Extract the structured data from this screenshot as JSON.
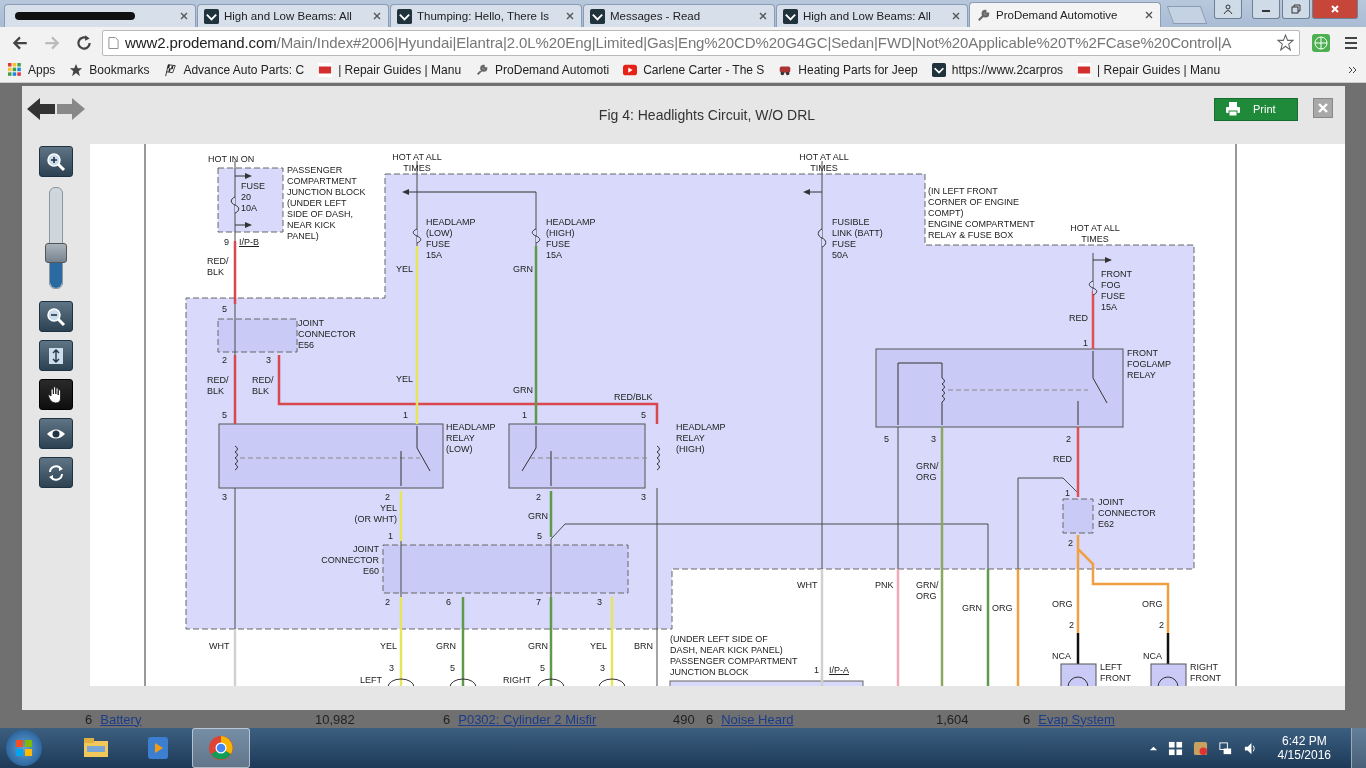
{
  "browser": {
    "tabs": [
      {
        "redacted": true,
        "selected": false
      },
      {
        "title": "High and Low Beams: All",
        "redacted": false,
        "selected": false
      },
      {
        "title": "Thumping: Hello, There Is",
        "redacted": false,
        "selected": false
      },
      {
        "title": "Messages - Read",
        "redacted": false,
        "selected": false
      },
      {
        "title": "High and Low Beams: All",
        "redacted": false,
        "selected": false
      },
      {
        "title": "ProDemand Automotive",
        "redacted": false,
        "selected": true
      }
    ],
    "url_host": "www2.prodemand.com",
    "url_path": "/Main/Index#2006|Hyundai|Elantra|2.0L%20Eng|Limited|Gas|Eng%20CD%20G4GC|Sedan|FWD|Not%20Applicable%20T%2FCase%20Control|A",
    "bookmarks": [
      "Apps",
      "Bookmarks",
      "Advance Auto Parts: C",
      "| Repair Guides | Manu",
      "ProDemand Automoti",
      "Carlene Carter - The S",
      "Heating Parts for Jeep",
      "https://www.2carpros",
      "| Repair Guides | Manu"
    ]
  },
  "viewer": {
    "title": "Fig 4: Headlights Circuit, W/O DRL",
    "print_label": "Print",
    "tools": [
      {
        "selected": false
      },
      {
        "selected": false
      },
      {
        "selected": false
      },
      {
        "selected": true
      },
      {
        "selected": false
      },
      {
        "selected": false
      }
    ],
    "zoom_slider": {
      "level": 0.35
    },
    "diagram_labels": [
      "HOT IN ON",
      "FUSE\n20\n10A",
      "PASSENGER\nCOMPARTMENT\nJUNCTION BLOCK\n(UNDER LEFT\nSIDE OF DASH,\nNEAR KICK\nPANEL)",
      "9",
      "I/P-B",
      "RED/\nBLK",
      "HOT AT ALL\nTIMES",
      "HEADLAMP\n(LOW)\nFUSE\n15A",
      "HEADLAMP\n(HIGH)\nFUSE\n15A",
      "YEL",
      "GRN",
      "5",
      "JOINT\nCONNECTOR\nE56",
      "2",
      "3",
      "RED/\nBLK",
      "RED/\nBLK",
      "YEL",
      "GRN",
      "RED/BLK",
      "5",
      "1",
      "1",
      "5",
      "HEADLAMP\nRELAY\n(LOW)",
      "HEADLAMP\nRELAY\n(HIGH)",
      "3",
      "2",
      "2",
      "3",
      "YEL\n(OR WHT)",
      "GRN",
      "1",
      "5",
      "JOINT\nCONNECTOR\nE60",
      "2",
      "6",
      "7",
      "3",
      "WHT",
      "YEL",
      "GRN",
      "GRN",
      "YEL",
      "BRN",
      "3",
      "5",
      "5",
      "3",
      "LEFT",
      "RIGHT",
      "HOT AT ALL\nTIMES",
      "FUSIBLE\nLINK (BATT)\nFUSE\n50A",
      "(IN LEFT FRONT\nCORNER OF ENGINE\nCOMPT)\nENGINE COMPARTMENT\nRELAY & FUSE BOX",
      "HOT AT ALL\nTIMES",
      "FRONT\nFOG\nFUSE\n15A",
      "RED",
      "1",
      "FRONT\nFOGLAMP\nRELAY",
      "5",
      "3",
      "2",
      "RED",
      "GRN/\nORG",
      "1",
      "JOINT\nCONNECTOR\nE62",
      "2",
      "WHT",
      "PNK",
      "GRN/\nORG",
      "GRN",
      "ORG",
      "ORG",
      "ORG",
      "2",
      "2",
      "NCA",
      "NCA",
      "LEFT\nFRONT",
      "RIGHT\nFRONT",
      "(UNDER LEFT SIDE OF\nDASH, NEAR KICK PANEL)\nPASSENGER COMPARTMENT\nJUNCTION BLOCK",
      "1",
      "I/P-A"
    ]
  },
  "background_list": [
    {
      "rank": "6",
      "name": "Battery",
      "count": "10,982"
    },
    {
      "rank": "6",
      "name": "P0302: Cylinder 2 Misfir",
      "count": "490"
    },
    {
      "rank": "6",
      "name": "Noise Heard",
      "count": "1,604"
    },
    {
      "rank": "6",
      "name": "Evap System"
    }
  ],
  "taskbar": {
    "apps": [
      {
        "selected": false
      },
      {
        "selected": false
      },
      {
        "selected": true
      }
    ],
    "time": "6:42 PM",
    "date": "4/15/2016"
  }
}
